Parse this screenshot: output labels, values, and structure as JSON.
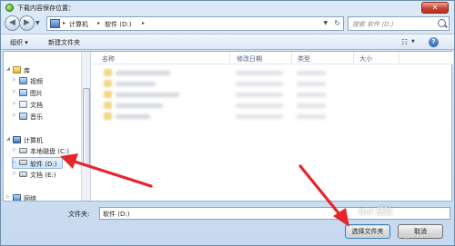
{
  "window": {
    "title": "下载内容保存位置："
  },
  "address": {
    "crumbs": [
      "计算机",
      "软件 (D:)"
    ],
    "search_placeholder": "搜索 软件 (D:)"
  },
  "toolbar": {
    "organize": "组织 ▾",
    "new_folder": "新建文件夹"
  },
  "nav": {
    "libraries": "库",
    "videos": "视频",
    "pictures": "图片",
    "documents": "文档",
    "music": "音乐",
    "computer": "计算机",
    "drive_c": "本地磁盘 (C:)",
    "drive_d": "软件 (D:)",
    "drive_e": "文档 (E:)",
    "network": "网络"
  },
  "columns": {
    "name": "名称",
    "date_modified": "修改日期",
    "type": "类型",
    "size": "大小"
  },
  "footer": {
    "folder_label": "文件夹:",
    "folder_value": "软件 (D:)",
    "select_button": "选择文件夹",
    "cancel_button": "取消"
  },
  "watermark": {
    "text": "Bai 经验",
    "url": "jingyan.baidu.com"
  },
  "colors": {
    "arrow": "#e5262b",
    "selection": "#cfe4fb"
  }
}
